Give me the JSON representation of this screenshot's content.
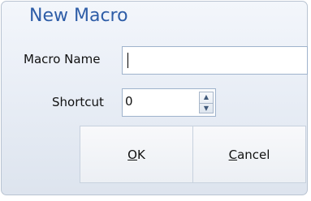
{
  "dialog": {
    "title": "New Macro",
    "name_label": "Macro Name",
    "name_value": "",
    "shortcut_label": "Shortcut",
    "shortcut_value": "0",
    "ok": {
      "accel": "O",
      "rest": "K"
    },
    "cancel": {
      "accel": "C",
      "rest": "ancel"
    }
  },
  "icons": {
    "spin_up": "triangle-up",
    "spin_down": "triangle-down"
  },
  "colors": {
    "title": "#2e5da7",
    "input_border": "#9fb3cc",
    "dialog_bg": "#e9eef6"
  }
}
